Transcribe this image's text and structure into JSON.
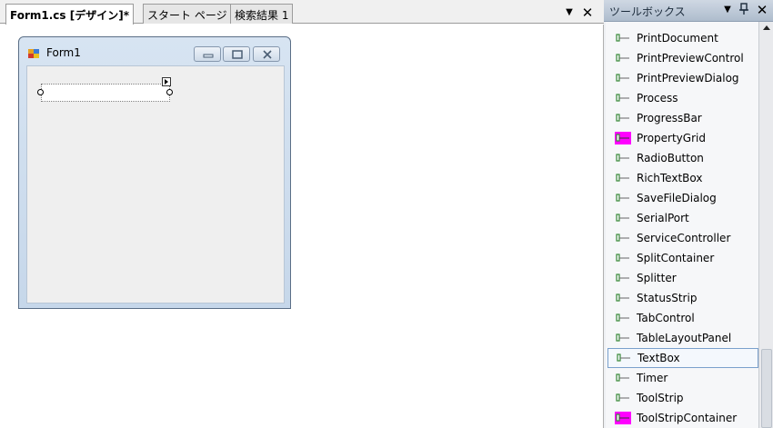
{
  "document": {
    "tabs": [
      {
        "label": "Form1.cs [デザイン]*",
        "active": true
      },
      {
        "label": "スタート ページ",
        "active": false
      },
      {
        "label": "検索結果 1",
        "active": false
      }
    ],
    "dropdown_glyph": "▼",
    "close_glyph": "✕"
  },
  "form": {
    "title": "Form1",
    "minimize_glyph": "▭",
    "maximize_glyph": "□",
    "close_glyph": "✕"
  },
  "toolbox": {
    "title": "ツールボックス",
    "dropdown_glyph": "▼",
    "pin_glyph": "ᵽ",
    "close_glyph": "✕",
    "selected_item": "TextBox",
    "items": [
      {
        "label": "PrintDocument",
        "icon": "component-icon"
      },
      {
        "label": "PrintPreviewControl",
        "icon": "component-icon"
      },
      {
        "label": "PrintPreviewDialog",
        "icon": "component-icon"
      },
      {
        "label": "Process",
        "icon": "component-icon"
      },
      {
        "label": "ProgressBar",
        "icon": "component-icon"
      },
      {
        "label": "PropertyGrid",
        "icon": "propertygrid-icon"
      },
      {
        "label": "RadioButton",
        "icon": "component-icon"
      },
      {
        "label": "RichTextBox",
        "icon": "component-icon"
      },
      {
        "label": "SaveFileDialog",
        "icon": "component-icon"
      },
      {
        "label": "SerialPort",
        "icon": "component-icon"
      },
      {
        "label": "ServiceController",
        "icon": "component-icon"
      },
      {
        "label": "SplitContainer",
        "icon": "component-icon"
      },
      {
        "label": "Splitter",
        "icon": "component-icon"
      },
      {
        "label": "StatusStrip",
        "icon": "component-icon"
      },
      {
        "label": "TabControl",
        "icon": "component-icon"
      },
      {
        "label": "TableLayoutPanel",
        "icon": "component-icon"
      },
      {
        "label": "TextBox",
        "icon": "component-icon"
      },
      {
        "label": "Timer",
        "icon": "component-icon"
      },
      {
        "label": "ToolStrip",
        "icon": "component-icon"
      },
      {
        "label": "ToolStripContainer",
        "icon": "toolstripcontainer-icon"
      }
    ]
  },
  "colors": {
    "accent_magenta": "#ff00ff",
    "icon_green": "#3a8a3a",
    "selection_border": "#7aa0cc"
  }
}
